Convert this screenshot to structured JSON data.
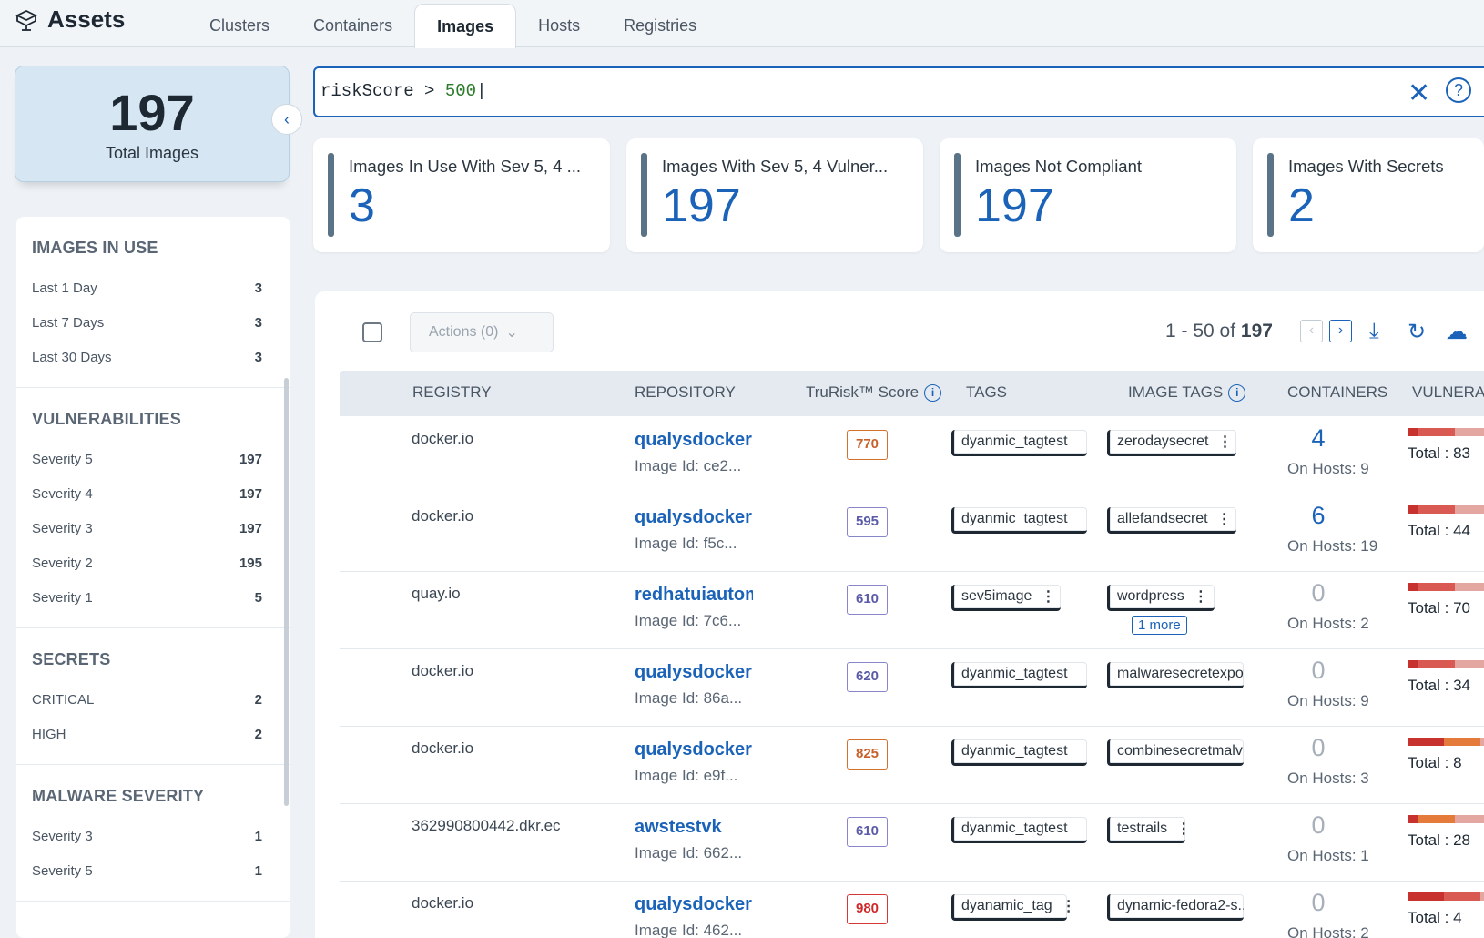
{
  "app": {
    "title": "Assets"
  },
  "tabs": [
    {
      "label": "Clusters"
    },
    {
      "label": "Containers"
    },
    {
      "label": "Images",
      "active": true
    },
    {
      "label": "Hosts"
    },
    {
      "label": "Registries"
    }
  ],
  "summary": {
    "total": "197",
    "label": "Total Images"
  },
  "filters": {
    "in_use": {
      "title": "IMAGES IN USE",
      "items": [
        {
          "label": "Last 1 Day",
          "count": "3"
        },
        {
          "label": "Last 7 Days",
          "count": "3"
        },
        {
          "label": "Last 30 Days",
          "count": "3"
        }
      ]
    },
    "vulns": {
      "title": "VULNERABILITIES",
      "items": [
        {
          "label": "Severity 5",
          "count": "197"
        },
        {
          "label": "Severity 4",
          "count": "197"
        },
        {
          "label": "Severity 3",
          "count": "197"
        },
        {
          "label": "Severity 2",
          "count": "195"
        },
        {
          "label": "Severity 1",
          "count": "5"
        }
      ]
    },
    "secrets": {
      "title": "SECRETS",
      "items": [
        {
          "label": "CRITICAL",
          "count": "2"
        },
        {
          "label": "HIGH",
          "count": "2"
        }
      ]
    },
    "malware": {
      "title": "MALWARE SEVERITY",
      "items": [
        {
          "label": "Severity 3",
          "count": "1"
        },
        {
          "label": "Severity 5",
          "count": "1"
        }
      ]
    }
  },
  "search": {
    "field": "riskScore",
    "op": ">",
    "value": "500"
  },
  "kpis": [
    {
      "title": "Images In Use With Sev 5, 4 ...",
      "value": "3"
    },
    {
      "title": "Images With Sev 5, 4 Vulner...",
      "value": "197"
    },
    {
      "title": "Images Not Compliant",
      "value": "197"
    },
    {
      "title": "Images With Secrets",
      "value": "2"
    }
  ],
  "toolbar": {
    "actions_label": "Actions (0)",
    "range": "1 - 50 of",
    "total": "197"
  },
  "columns": {
    "registry": "REGISTRY",
    "repository": "REPOSITORY",
    "score": "TruRisk™ Score",
    "tags": "TAGS",
    "image_tags": "IMAGE TAGS",
    "containers": "CONTAINERS",
    "vulnerabilities": "VULNERA"
  },
  "rows": [
    {
      "registry": "docker.io",
      "repo": "qualysdocker",
      "image_id": "Image Id: ce2...",
      "score": "770",
      "score_color": "orange",
      "tag": "dyanmic_tagtest",
      "image_tag": "zerodaysecret",
      "more": "",
      "containers": "4",
      "on_hosts": "On Hosts: 9",
      "total": "Total : 83"
    },
    {
      "registry": "docker.io",
      "repo": "qualysdocker",
      "image_id": "Image Id: f5c...",
      "score": "595",
      "score_color": "purple",
      "tag": "dyanmic_tagtest",
      "image_tag": "allefandsecret",
      "more": "",
      "containers": "6",
      "on_hosts": "On Hosts: 19",
      "total": "Total : 44"
    },
    {
      "registry": "quay.io",
      "repo": "redhatuiautomation",
      "image_id": "Image Id: 7c6...",
      "score": "610",
      "score_color": "purple",
      "tag": "sev5image",
      "image_tag": "wordpress",
      "more": "1 more",
      "containers": "0",
      "on_hosts": "On Hosts: 2",
      "total": "Total : 70"
    },
    {
      "registry": "docker.io",
      "repo": "qualysdocker",
      "image_id": "Image Id: 86a...",
      "score": "620",
      "score_color": "purple",
      "tag": "dyanmic_tagtest",
      "image_tag": "malwaresecretexpo",
      "more": "",
      "containers": "0",
      "on_hosts": "On Hosts: 9",
      "total": "Total : 34"
    },
    {
      "registry": "docker.io",
      "repo": "qualysdocker",
      "image_id": "Image Id: e9f...",
      "score": "825",
      "score_color": "orange",
      "tag": "dyanmic_tagtest",
      "image_tag": "combinesecretmalv",
      "more": "",
      "containers": "0",
      "on_hosts": "On Hosts: 3",
      "total": "Total : 8"
    },
    {
      "registry": "362990800442.dkr.ec",
      "repo": "awstestvk",
      "image_id": "Image Id: 662...",
      "score": "610",
      "score_color": "purple",
      "tag": "dyanmic_tagtest",
      "image_tag": "testrails",
      "more": "",
      "containers": "0",
      "on_hosts": "On Hosts: 1",
      "total": "Total : 28"
    },
    {
      "registry": "docker.io",
      "repo": "qualysdocker",
      "image_id": "Image Id: 462...",
      "score": "980",
      "score_color": "red",
      "tag": "dyanamic_tag",
      "image_tag": "dynamic-fedora2-s...",
      "more": "",
      "containers": "0",
      "on_hosts": "On Hosts: 2",
      "total": "Total : 4"
    }
  ]
}
